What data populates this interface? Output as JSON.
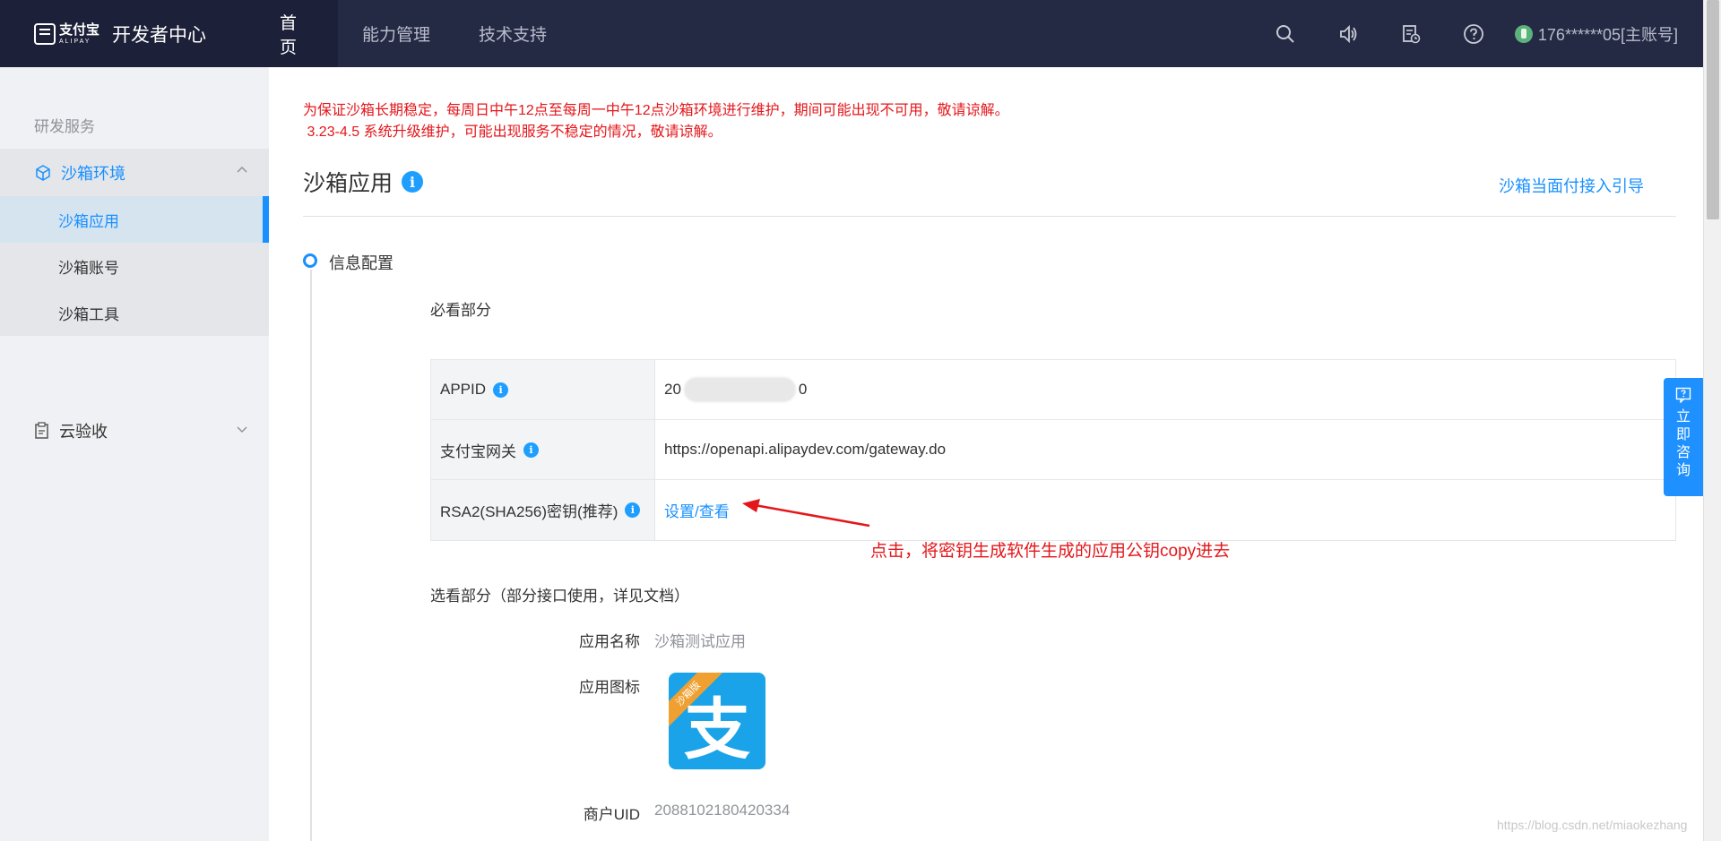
{
  "header": {
    "logo_cn": "支付宝",
    "logo_en": "ALIPAY",
    "brand_title": "开发者中心",
    "nav": [
      {
        "label": "首页"
      },
      {
        "label": "能力管理"
      },
      {
        "label": "技术支持"
      }
    ],
    "user_label": "176******05[主账号]"
  },
  "sidebar": {
    "section_title": "研发服务",
    "group_label": "沙箱环境",
    "sub_items": [
      {
        "label": "沙箱应用"
      },
      {
        "label": "沙箱账号"
      },
      {
        "label": "沙箱工具"
      }
    ],
    "group2_label": "云验收"
  },
  "main": {
    "notice_line1": "为保证沙箱长期稳定，每周日中午12点至每周一中午12点沙箱环境进行维护，期间可能出现不可用，敬请谅解。",
    "notice_line2": " 3.23-4.5 系统升级维护，可能出现服务不稳定的情况，敬请谅解。",
    "page_title": "沙箱应用",
    "guide_link": "沙箱当面付接入引导",
    "step_label": "信息配置",
    "required_heading": "必看部分",
    "kv": [
      {
        "key": "APPID",
        "value_prefix": "20",
        "value_suffix": "0"
      },
      {
        "key": "支付宝网关",
        "value": "https://openapi.alipaydev.com/gateway.do"
      },
      {
        "key": "RSA2(SHA256)密钥(推荐)",
        "link": "设置/查看"
      }
    ],
    "annotation": "点击，将密钥生成软件生成的应用公钥copy进去",
    "optional_heading": "选看部分（部分接口使用，详见文档）",
    "form": {
      "app_name_label": "应用名称",
      "app_name_value": "沙箱测试应用",
      "app_icon_label": "应用图标",
      "app_icon_ribbon": "沙箱版",
      "app_icon_glyph": "支",
      "merchant_uid_label": "商户UID",
      "merchant_uid_value": "2088102180420334"
    },
    "info_glyph": "i"
  },
  "float_consult": {
    "label": "立即咨询"
  },
  "watermark": "https://blog.csdn.net/miaokezhang",
  "colors": {
    "topbar": "#252a44",
    "accent": "#1890ff",
    "notice_red": "#e4161a",
    "sidebar_bg": "#f0f1f4"
  }
}
